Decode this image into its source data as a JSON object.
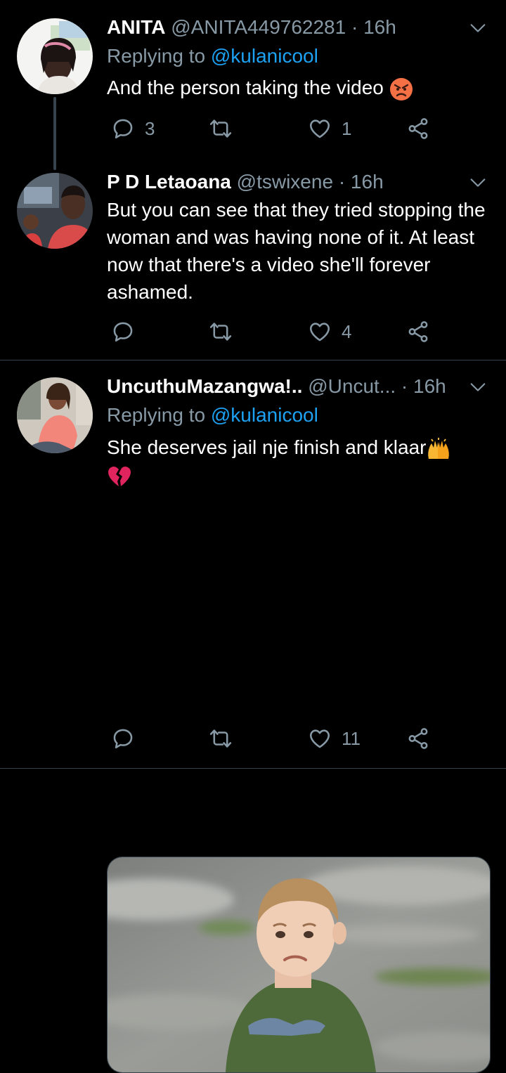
{
  "tweets": [
    {
      "name": "ANITA",
      "handle": "@ANITA449762281",
      "dot": "·",
      "time": "16h",
      "replying_prefix": "Replying to ",
      "replying_mention": "@kulanicool",
      "text": "And the person taking the video",
      "emoji": "angry-face",
      "replies": "3",
      "retweets": "",
      "likes": "1"
    },
    {
      "name": "P D Letaoana",
      "handle": "@tswixene",
      "dot": "·",
      "time": "16h",
      "text": "But you can see that they tried stopping the woman and was having none of it. At least now that there's a video she'll forever ashamed.",
      "replies": "",
      "retweets": "",
      "likes": "4"
    },
    {
      "name": "UncuthuMazangwa!..",
      "handle": "@Uncut...",
      "dot": "·",
      "time": "16h",
      "replying_prefix": "Replying to ",
      "replying_mention": "@kulanicool",
      "text": "She deserves jail nje finish and klaar",
      "emojis": [
        "raising-hands",
        "broken-heart"
      ],
      "media": "photo of crying toddler in green t-shirt",
      "replies": "",
      "retweets": "",
      "likes": "11"
    }
  ],
  "colors": {
    "background": "#000000",
    "text": "#ffffff",
    "muted": "#8899a6",
    "link": "#1da1f2",
    "divider": "#38444d"
  },
  "icons": [
    "reply-icon",
    "retweet-icon",
    "like-icon",
    "share-icon",
    "chevron-down-icon"
  ]
}
